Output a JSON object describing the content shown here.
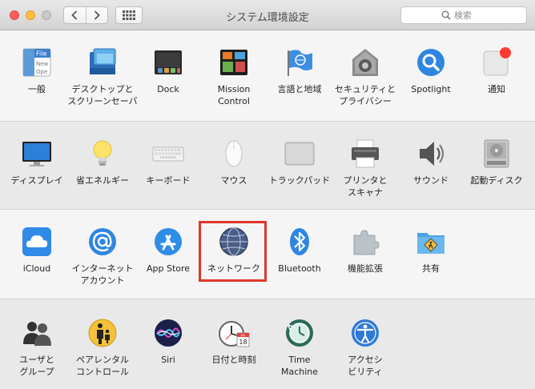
{
  "window": {
    "title": "システム環境設定"
  },
  "search": {
    "placeholder": "検索"
  },
  "colors": {
    "highlight": "#e0352b",
    "notification_dot": "#ff3b30",
    "traffic_close": "#fc605c",
    "traffic_min": "#fdbc40"
  },
  "sections": [
    {
      "items": [
        {
          "label": "一般",
          "icon": "general-icon",
          "file_text": "File",
          "file_text2": "New",
          "file_text3": "Ope"
        },
        {
          "label": "デスクトップと\nスクリーンセーバ",
          "icon": "desktop-screensaver-icon"
        },
        {
          "label": "Dock",
          "icon": "dock-icon"
        },
        {
          "label": "Mission\nControl",
          "icon": "mission-control-icon"
        },
        {
          "label": "言語と地域",
          "icon": "language-region-icon"
        },
        {
          "label": "セキュリティと\nプライバシー",
          "icon": "security-privacy-icon"
        },
        {
          "label": "Spotlight",
          "icon": "spotlight-icon"
        },
        {
          "label": "通知",
          "icon": "notifications-icon"
        }
      ]
    },
    {
      "items": [
        {
          "label": "ディスプレイ",
          "icon": "displays-icon"
        },
        {
          "label": "省エネルギー",
          "icon": "energy-saver-icon"
        },
        {
          "label": "キーボード",
          "icon": "keyboard-icon"
        },
        {
          "label": "マウス",
          "icon": "mouse-icon"
        },
        {
          "label": "トラックパッド",
          "icon": "trackpad-icon"
        },
        {
          "label": "プリンタと\nスキャナ",
          "icon": "printer-scanner-icon"
        },
        {
          "label": "サウンド",
          "icon": "sound-icon"
        },
        {
          "label": "起動ディスク",
          "icon": "startup-disk-icon"
        }
      ]
    },
    {
      "items": [
        {
          "label": "iCloud",
          "icon": "icloud-icon"
        },
        {
          "label": "インターネット\nアカウント",
          "icon": "internet-accounts-icon"
        },
        {
          "label": "App Store",
          "icon": "app-store-icon"
        },
        {
          "label": "ネットワーク",
          "icon": "network-icon"
        },
        {
          "label": "Bluetooth",
          "icon": "bluetooth-icon"
        },
        {
          "label": "機能拡張",
          "icon": "extensions-icon"
        },
        {
          "label": "共有",
          "icon": "sharing-icon"
        }
      ]
    },
    {
      "items": [
        {
          "label": "ユーザと\nグループ",
          "icon": "users-groups-icon"
        },
        {
          "label": "ペアレンタル\nコントロール",
          "icon": "parental-controls-icon"
        },
        {
          "label": "Siri",
          "icon": "siri-icon"
        },
        {
          "label": "日付と時刻",
          "icon": "date-time-icon",
          "cal_month": "JUL",
          "cal_day": "18"
        },
        {
          "label": "Time\nMachine",
          "icon": "time-machine-icon"
        },
        {
          "label": "アクセシ\nビリティ",
          "icon": "accessibility-icon"
        }
      ]
    }
  ]
}
